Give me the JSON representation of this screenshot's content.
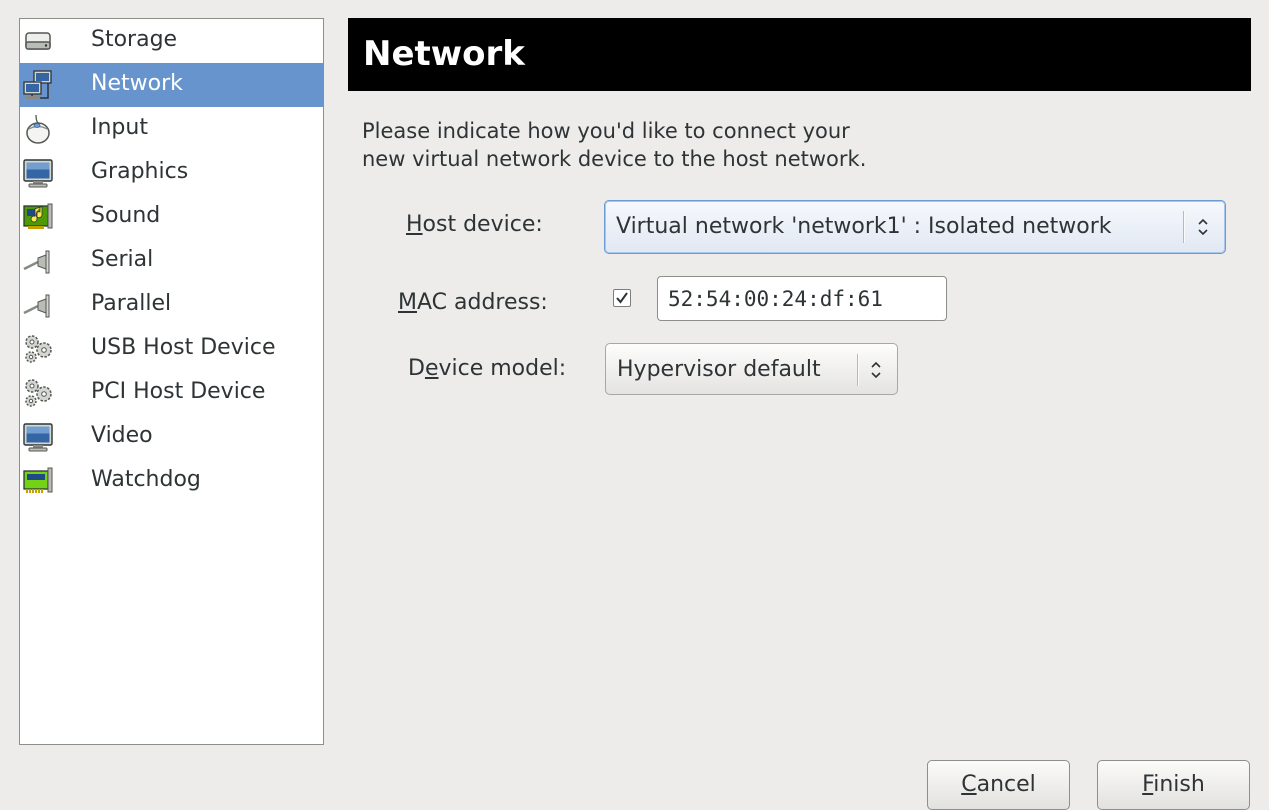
{
  "window": {
    "page_title": "Network",
    "intro_line1": "Please indicate how you'd like to connect your",
    "intro_line2": "new virtual network device to the host network."
  },
  "device_list": {
    "selected": "Network",
    "items": [
      {
        "label": "Storage",
        "icon": "hard-disk-icon"
      },
      {
        "label": "Network",
        "icon": "network-icon"
      },
      {
        "label": "Input",
        "icon": "mouse-icon"
      },
      {
        "label": "Graphics",
        "icon": "monitor-icon"
      },
      {
        "label": "Sound",
        "icon": "sound-card-icon"
      },
      {
        "label": "Serial",
        "icon": "serial-port-icon"
      },
      {
        "label": "Parallel",
        "icon": "parallel-port-icon"
      },
      {
        "label": "USB Host Device",
        "icon": "gears-icon"
      },
      {
        "label": "PCI Host Device",
        "icon": "gears-icon"
      },
      {
        "label": "Video",
        "icon": "monitor-icon"
      },
      {
        "label": "Watchdog",
        "icon": "expansion-card-icon"
      }
    ]
  },
  "form": {
    "host_device": {
      "mnemonic": "H",
      "label_rest": "ost device:",
      "value": "Virtual network 'network1' : Isolated network"
    },
    "mac_address": {
      "mnemonic": "M",
      "label_rest": "AC address:",
      "checked": true,
      "value": "52:54:00:24:df:61"
    },
    "device_model": {
      "label_pre": "D",
      "mnemonic": "e",
      "label_rest": "vice model:",
      "value": "Hypervisor default"
    }
  },
  "buttons": {
    "cancel": {
      "mnemonic": "C",
      "rest": "ancel"
    },
    "finish": {
      "mnemonic": "F",
      "rest": "inish"
    }
  },
  "colors": {
    "selection": "#6794cc",
    "header_bg": "#000000",
    "window_bg": "#edeceb"
  }
}
